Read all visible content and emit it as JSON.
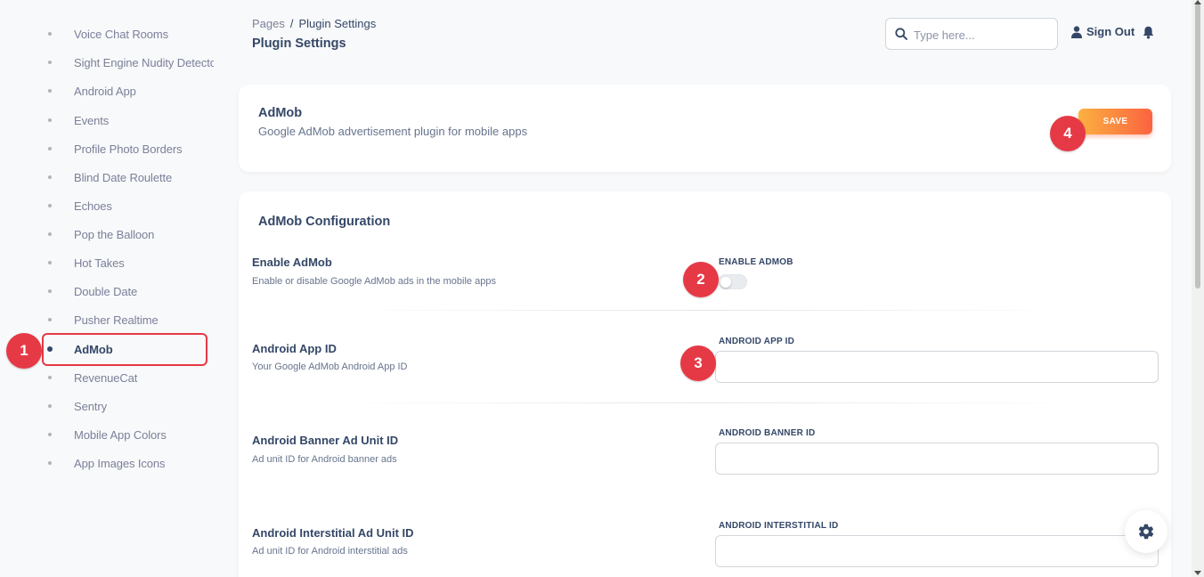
{
  "sidebar": {
    "items": [
      {
        "label": "Voice Chat Rooms"
      },
      {
        "label": "Sight Engine Nudity Detector"
      },
      {
        "label": "Android App"
      },
      {
        "label": "Events"
      },
      {
        "label": "Profile Photo Borders"
      },
      {
        "label": "Blind Date Roulette"
      },
      {
        "label": "Echoes"
      },
      {
        "label": "Pop the Balloon"
      },
      {
        "label": "Hot Takes"
      },
      {
        "label": "Double Date"
      },
      {
        "label": "Pusher Realtime"
      },
      {
        "label": "AdMob",
        "active": true
      },
      {
        "label": "RevenueCat"
      },
      {
        "label": "Sentry"
      },
      {
        "label": "Mobile App Colors"
      },
      {
        "label": "App Images Icons"
      }
    ]
  },
  "header": {
    "breadcrumb_root": "Pages",
    "breadcrumb_separator": "/",
    "breadcrumb_current": "Plugin Settings",
    "title": "Plugin Settings",
    "search_placeholder": "Type here...",
    "sign_out": "Sign Out"
  },
  "plugin": {
    "name": "AdMob",
    "description": "Google AdMob advertisement plugin for mobile apps",
    "save_label": "SAVE"
  },
  "config": {
    "title": "AdMob Configuration",
    "rows": [
      {
        "title": "Enable AdMob",
        "desc": "Enable or disable Google AdMob ads in the mobile apps",
        "field_label": "ENABLE ADMOB",
        "type": "toggle",
        "enabled": false
      },
      {
        "title": "Android App ID",
        "desc": "Your Google AdMob Android App ID",
        "field_label": "ANDROID APP ID",
        "type": "text",
        "value": ""
      },
      {
        "title": "Android Banner Ad Unit ID",
        "desc": "Ad unit ID for Android banner ads",
        "field_label": "ANDROID BANNER ID",
        "type": "text",
        "value": ""
      },
      {
        "title": "Android Interstitial Ad Unit ID",
        "desc": "Ad unit ID for Android interstitial ads",
        "field_label": "ANDROID INTERSTITIAL ID",
        "type": "text",
        "value": ""
      }
    ]
  },
  "annotations": [
    "1",
    "2",
    "3",
    "4"
  ],
  "colors": {
    "accent_start": "#fbb140",
    "accent_end": "#fb6340",
    "badge": "#e63946",
    "text": "#344767"
  }
}
